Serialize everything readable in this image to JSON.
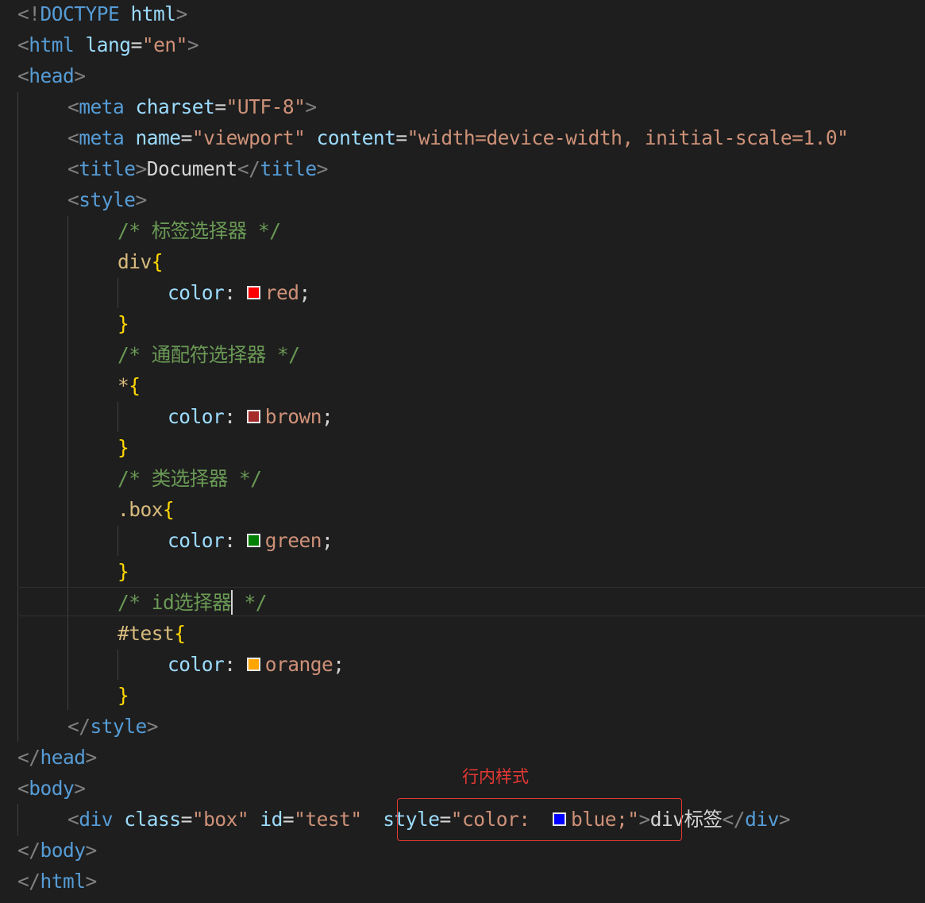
{
  "editor": {
    "lines": {
      "doctype": [
        "<!",
        "DOCTYPE",
        " ",
        "html",
        ">"
      ],
      "html_open": [
        "<",
        "html",
        " ",
        "lang",
        "=",
        "\"en\"",
        ">"
      ],
      "head_open": [
        "<",
        "head",
        ">"
      ],
      "meta_charset": [
        "<",
        "meta",
        " ",
        "charset",
        "=",
        "\"UTF-8\"",
        ">"
      ],
      "meta_viewport": [
        "<",
        "meta",
        " ",
        "name",
        "=",
        "\"viewport\"",
        " ",
        "content",
        "=",
        "\"width=device-width, initial-scale=1.0\""
      ],
      "title": [
        "<",
        "title",
        ">",
        "Document",
        "</",
        "title",
        ">"
      ],
      "style_open": [
        "<",
        "style",
        ">"
      ],
      "comment_tag": "/* 标签选择器 */",
      "div_rule": [
        "div",
        "{"
      ],
      "color_red": [
        "color",
        ": ",
        "red",
        ";"
      ],
      "close_1": "}",
      "comment_universal": "/* 通配符选择器 */",
      "star_rule": [
        "*",
        "{"
      ],
      "color_brown": [
        "color",
        ": ",
        "brown",
        ";"
      ],
      "close_2": "}",
      "comment_class": "/* 类选择器 */",
      "box_rule": [
        ".box",
        "{"
      ],
      "color_green": [
        "color",
        ": ",
        "green",
        ";"
      ],
      "close_3": "}",
      "comment_id_before": "/* id选择器",
      "comment_id_after": " */",
      "test_rule": [
        "#test",
        "{"
      ],
      "color_orange": [
        "color",
        ": ",
        "orange",
        ";"
      ],
      "close_4": "}",
      "style_close": [
        "</",
        "style",
        ">"
      ],
      "head_close": [
        "</",
        "head",
        ">"
      ],
      "body_open": [
        "<",
        "body",
        ">"
      ],
      "div_line": [
        "<",
        "div",
        " ",
        "class",
        "=",
        "\"box\"",
        " ",
        "id",
        "=",
        "\"test\"",
        " ",
        "style",
        "=",
        "\"color: ",
        "blue;\"",
        ">",
        "div标签",
        "</",
        "div",
        ">"
      ],
      "body_close": [
        "</",
        "body",
        ">"
      ],
      "html_close": [
        "</",
        "html",
        ">"
      ]
    }
  },
  "colors": {
    "red": "#ff0000",
    "brown": "#a52a2a",
    "green": "#008000",
    "orange": "#ffa500",
    "blue": "#0000ff",
    "annotation": "#e53935"
  },
  "annotation": {
    "label": "行内样式"
  }
}
